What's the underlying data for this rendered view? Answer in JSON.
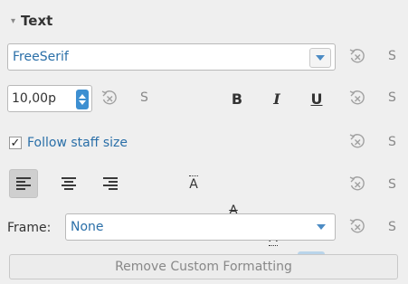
{
  "section": {
    "title": "Text",
    "collapse_glyph": "▾"
  },
  "font_face": {
    "value": "FreeSerif",
    "icon": "chevron-down-icon"
  },
  "font_size": {
    "value": "10,00p"
  },
  "style_buttons": {
    "bold": "B",
    "italic": "I",
    "underline": "U"
  },
  "follow_staff": {
    "label": "Follow staff size",
    "checked": true,
    "check_glyph": "✓"
  },
  "vertical_align_glyphs": {
    "top": "A",
    "center": "A",
    "baseline": "A",
    "bottom": "A"
  },
  "frame": {
    "label": "Frame:",
    "value": "None"
  },
  "style_marker": "S",
  "remove_button": {
    "label": "Remove Custom Formatting"
  },
  "colors": {
    "accent": "#3d8fd1",
    "link_text": "#2a6fa8",
    "active_toggle": "#b9d4ea",
    "panel_bg": "#efefef"
  }
}
